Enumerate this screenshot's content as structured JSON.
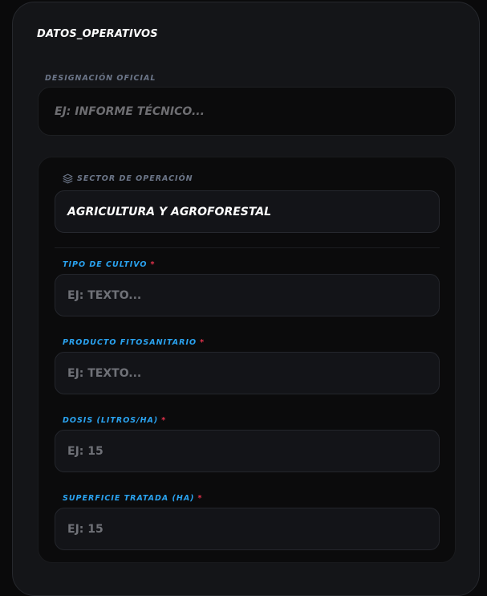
{
  "panel": {
    "title": "DATOS_OPERATIVOS"
  },
  "designation": {
    "label": "DESIGNACIÓN OFICIAL",
    "placeholder": "EJ: INFORME TÉCNICO..."
  },
  "sector": {
    "label": "SECTOR DE OPERACIÓN",
    "icon": "layers-icon",
    "value": "AGRICULTURA Y AGROFORESTAL"
  },
  "fields": [
    {
      "label": "TIPO DE CULTIVO",
      "required": "*",
      "placeholder": "EJ: TEXTO..."
    },
    {
      "label": "PRODUCTO FITOSANITARIO",
      "required": "*",
      "placeholder": "EJ: TEXTO..."
    },
    {
      "label": "DOSIS (LITROS/HA)",
      "required": "*",
      "placeholder": "EJ: 15"
    },
    {
      "label": "SUPERFICIE TRATADA (HA)",
      "required": "*",
      "placeholder": "EJ: 15"
    }
  ],
  "colors": {
    "background": "#0a0a0b",
    "panel": "#141518",
    "field_label": "#2aa3f0",
    "required": "#e6334d",
    "muted_label": "#6c7689"
  }
}
